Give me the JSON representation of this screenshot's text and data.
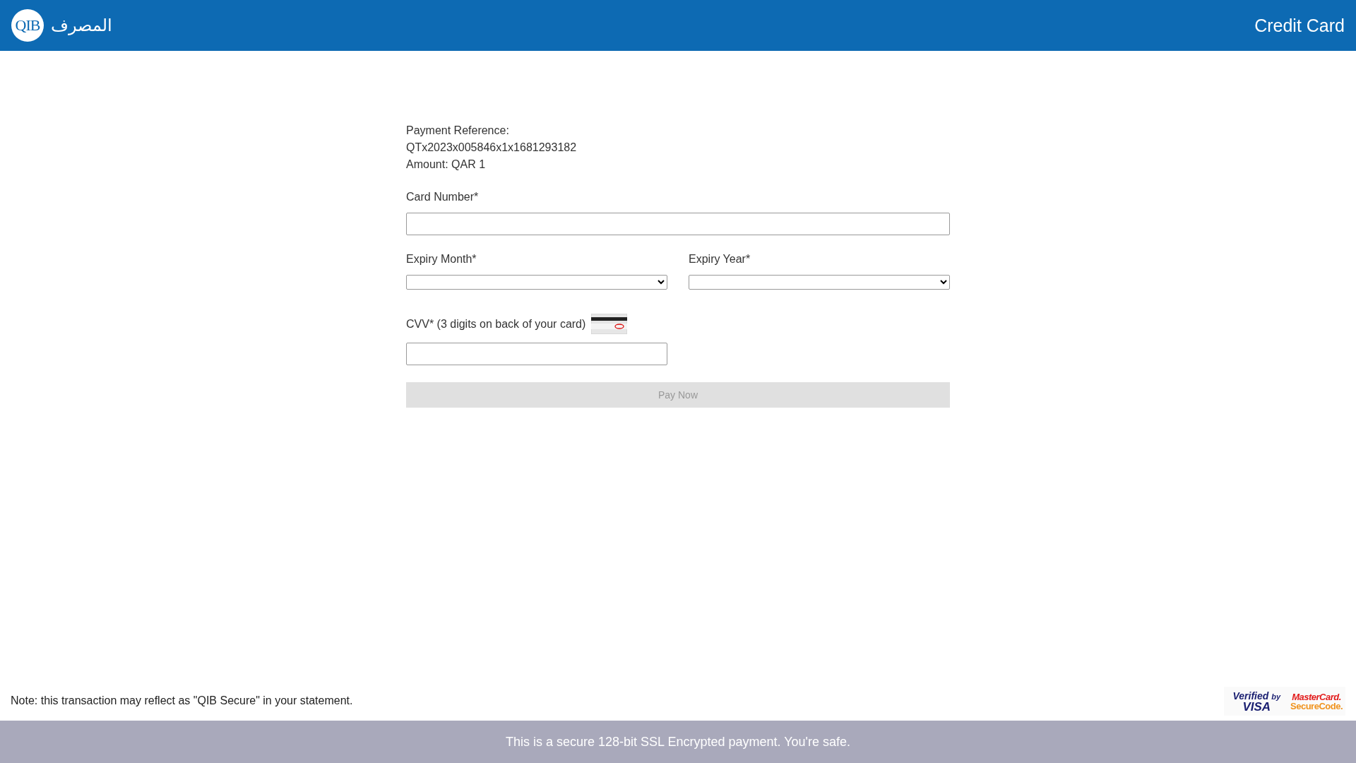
{
  "header": {
    "logo": {
      "monogram": "QIB",
      "arabic_name": "المصرف"
    },
    "title": "Credit Card"
  },
  "payment": {
    "reference_label": "Payment Reference:",
    "reference": "QTx2023x005846x1x1681293182",
    "amount": "Amount: QAR 1"
  },
  "form": {
    "card_number": {
      "label": "Card Number*"
    },
    "expiry_month": {
      "label": "Expiry Month*"
    },
    "expiry_year": {
      "label": "Expiry Year*"
    },
    "cvv": {
      "label": "CVV* (3 digits on back of your card)"
    },
    "pay_button": {
      "label": "Pay Now",
      "disabled": true
    }
  },
  "note": "Note: this transaction may reflect as \"QIB Secure\" in your statement.",
  "badges": {
    "visa": {
      "line_1": "Verified",
      "line_2": "by",
      "line_3": "VISA"
    },
    "mastercard": {
      "line_1": "MasterCard.",
      "line_2": "SecureCode."
    }
  },
  "footer": "This is a secure 128-bit SSL Encrypted payment. You're safe."
}
